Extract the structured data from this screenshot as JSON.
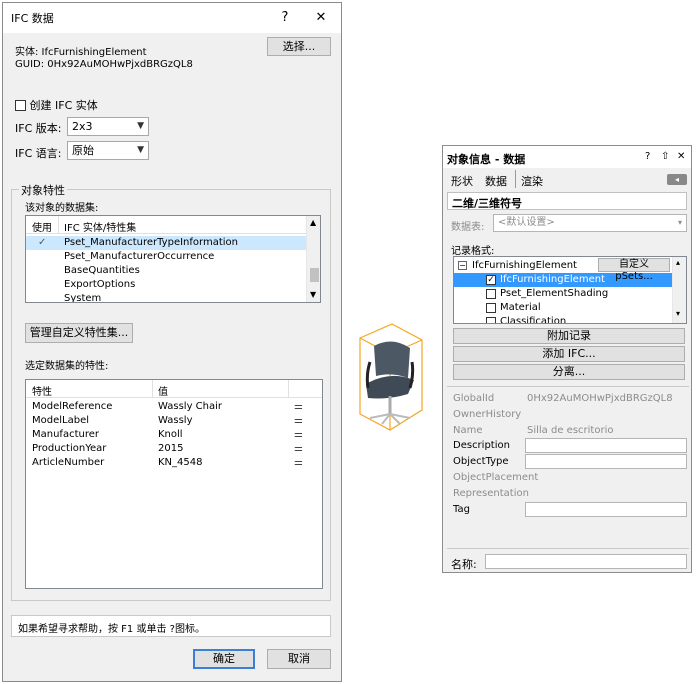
{
  "dialog": {
    "title": "IFC 数据",
    "help_icon": "?",
    "close_icon": "✕",
    "entity_label": "实体: IfcFurnishingElement",
    "guid_label": "GUID: 0Hx92AuMOHwPjxdBRGzQL8",
    "select_button": "选择...",
    "create_entity_label": "创建 IFC 实体",
    "version_label": "IFC 版本:",
    "version_value": "2x3",
    "language_label": "IFC 语言:",
    "language_value": "原始",
    "object_props_legend": "对象特性",
    "datasets_label": "该对象的数据集:",
    "dataset_columns": [
      "使用",
      "IFC 实体/特性集"
    ],
    "datasets": [
      {
        "used": true,
        "name": "Pset_ManufacturerTypeInformation"
      },
      {
        "used": false,
        "name": "Pset_ManufacturerOccurrence"
      },
      {
        "used": false,
        "name": "BaseQuantities"
      },
      {
        "used": false,
        "name": "ExportOptions"
      },
      {
        "used": false,
        "name": "System"
      }
    ],
    "manage_button": "管理自定义特性集...",
    "selected_props_label": "选定数据集的特性:",
    "prop_columns": [
      "特性",
      "值"
    ],
    "properties": [
      {
        "name": "ModelReference",
        "value": "Wassly Chair"
      },
      {
        "name": "ModelLabel",
        "value": "Wassly"
      },
      {
        "name": "Manufacturer",
        "value": "Knoll"
      },
      {
        "name": "ProductionYear",
        "value": "2015"
      },
      {
        "name": "ArticleNumber",
        "value": "KN_4548"
      }
    ],
    "help_text": "如果希望寻求帮助，按 F1 或单击 ?图标。",
    "ok_button": "确定",
    "cancel_button": "取消"
  },
  "palette": {
    "title": "对象信息 - 数据",
    "title_icons": [
      "?",
      "⇧",
      "✕"
    ],
    "tabs": [
      "形状",
      "数据",
      "渲染"
    ],
    "header": "二维/三维符号",
    "dataset_label": "数据表:",
    "dataset_value": "<默认设置>",
    "record_label": "记录格式:",
    "tree": [
      {
        "label": "IfcFurnishingElement",
        "level": 0,
        "checkbox": "minus"
      },
      {
        "label": "IfcFurnishingElement",
        "level": 1,
        "checkbox": "checked",
        "selected": true
      },
      {
        "label": "Pset_ElementShading",
        "level": 1,
        "checkbox": "empty"
      },
      {
        "label": "Material",
        "level": 1,
        "checkbox": "empty"
      },
      {
        "label": "Classification",
        "level": 1,
        "checkbox": "empty"
      }
    ],
    "custom_pset_button": "自定义 pSets...",
    "attach_button": "附加记录",
    "add_ifc_button": "添加 IFC...",
    "detach_button": "分离...",
    "fields": [
      {
        "label": "GlobalId",
        "value": "0Hx92AuMOHwPjxdBRGzQL8",
        "editable": false
      },
      {
        "label": "OwnerHistory",
        "value": "",
        "editable": false
      },
      {
        "label": "Name",
        "value": "Silla de escritorio",
        "editable": false
      },
      {
        "label": "Description",
        "value": "",
        "editable": true
      },
      {
        "label": "ObjectType",
        "value": "",
        "editable": true
      },
      {
        "label": "ObjectPlacement",
        "value": "",
        "editable": false
      },
      {
        "label": "Representation",
        "value": "",
        "editable": false
      },
      {
        "label": "Tag",
        "value": "",
        "editable": true
      }
    ],
    "name_label": "名称:",
    "name_value": ""
  }
}
